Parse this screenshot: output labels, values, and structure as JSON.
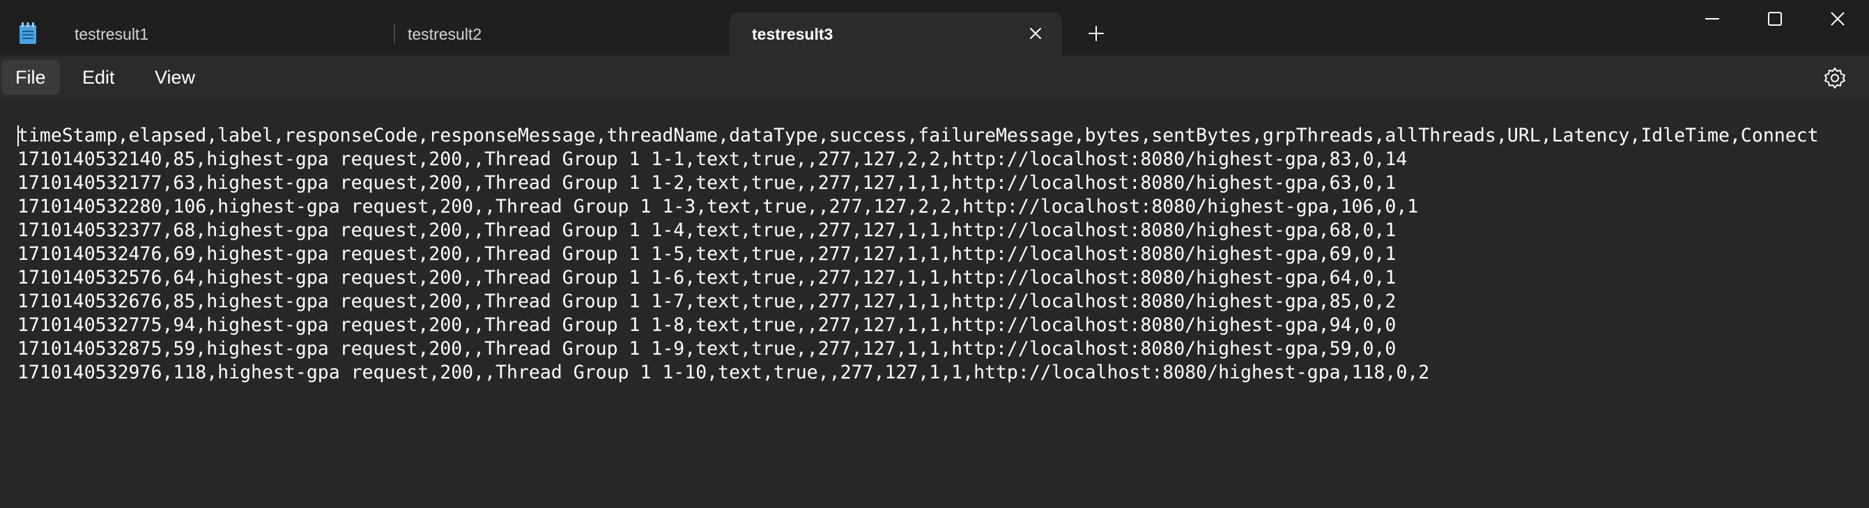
{
  "titlebar": {
    "app_icon": "notepad-icon",
    "tabs": [
      {
        "label": "testresult1",
        "active": false
      },
      {
        "label": "testresult2",
        "active": false
      },
      {
        "label": "testresult3",
        "active": true
      }
    ],
    "close_tab_icon": "close-icon",
    "new_tab_icon": "plus-icon",
    "window_controls": [
      "minimize-icon",
      "maximize-icon",
      "close-icon"
    ]
  },
  "menu": {
    "items": [
      {
        "label": "File",
        "active": true
      },
      {
        "label": "Edit",
        "active": false
      },
      {
        "label": "View",
        "active": false
      }
    ],
    "settings_icon": "gear-icon"
  },
  "editor": {
    "lines": [
      "timeStamp,elapsed,label,responseCode,responseMessage,threadName,dataType,success,failureMessage,bytes,sentBytes,grpThreads,allThreads,URL,Latency,IdleTime,Connect",
      "1710140532140,85,highest-gpa request,200,,Thread Group 1 1-1,text,true,,277,127,2,2,http://localhost:8080/highest-gpa,83,0,14",
      "1710140532177,63,highest-gpa request,200,,Thread Group 1 1-2,text,true,,277,127,1,1,http://localhost:8080/highest-gpa,63,0,1",
      "1710140532280,106,highest-gpa request,200,,Thread Group 1 1-3,text,true,,277,127,2,2,http://localhost:8080/highest-gpa,106,0,1",
      "1710140532377,68,highest-gpa request,200,,Thread Group 1 1-4,text,true,,277,127,1,1,http://localhost:8080/highest-gpa,68,0,1",
      "1710140532476,69,highest-gpa request,200,,Thread Group 1 1-5,text,true,,277,127,1,1,http://localhost:8080/highest-gpa,69,0,1",
      "1710140532576,64,highest-gpa request,200,,Thread Group 1 1-6,text,true,,277,127,1,1,http://localhost:8080/highest-gpa,64,0,1",
      "1710140532676,85,highest-gpa request,200,,Thread Group 1 1-7,text,true,,277,127,1,1,http://localhost:8080/highest-gpa,85,0,2",
      "1710140532775,94,highest-gpa request,200,,Thread Group 1 1-8,text,true,,277,127,1,1,http://localhost:8080/highest-gpa,94,0,0",
      "1710140532875,59,highest-gpa request,200,,Thread Group 1 1-9,text,true,,277,127,1,1,http://localhost:8080/highest-gpa,59,0,0",
      "1710140532976,118,highest-gpa request,200,,Thread Group 1 1-10,text,true,,277,127,1,1,http://localhost:8080/highest-gpa,118,0,2"
    ]
  },
  "colors": {
    "titlebar_bg": "#1f1f1f",
    "active_tab_bg": "#2b2b2b",
    "menubar_bg": "#2b2b2b",
    "editor_bg": "#272727",
    "text": "#ffffff",
    "app_icon_accent": "#4aa3df"
  }
}
